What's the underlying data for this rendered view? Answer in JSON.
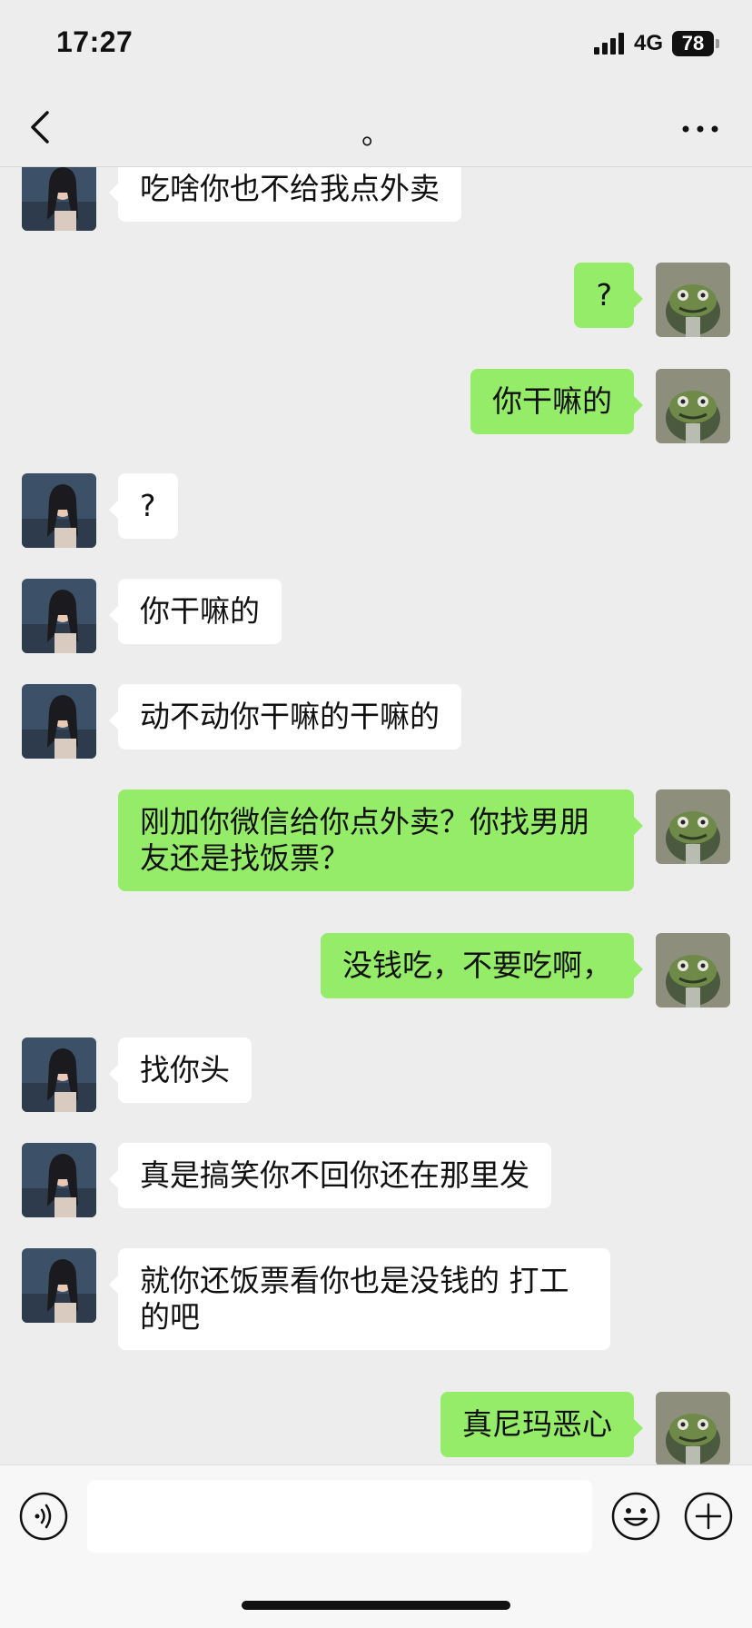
{
  "status_bar": {
    "time": "17:27",
    "network": "4G",
    "battery": "78"
  },
  "nav": {
    "title": "。"
  },
  "messages": [
    {
      "side": "left",
      "text": "吃啥你也不给我点外卖"
    },
    {
      "side": "right",
      "text": "?"
    },
    {
      "side": "right",
      "text": "你干嘛的"
    },
    {
      "side": "left",
      "text": "?"
    },
    {
      "side": "left",
      "text": "你干嘛的"
    },
    {
      "side": "left",
      "text": "动不动你干嘛的干嘛的"
    },
    {
      "side": "right",
      "text": "刚加你微信给你点外卖？你找男朋友还是找饭票？"
    },
    {
      "side": "right",
      "text": "没钱吃，不要吃啊，"
    },
    {
      "side": "left",
      "text": "找你头"
    },
    {
      "side": "left",
      "text": "真是搞笑你不回你还在那里发"
    },
    {
      "side": "left",
      "text": "就你还饭票看你也是没钱的 打工的吧"
    },
    {
      "side": "right",
      "text": "真尼玛恶心"
    }
  ],
  "input": {
    "value": "",
    "placeholder": ""
  },
  "icons": {
    "back": "back-chevron-icon",
    "more": "more-dots-icon",
    "voice": "voice-icon",
    "emoji": "emoji-icon",
    "plus": "plus-icon",
    "signal": "signal-icon"
  },
  "colors": {
    "background": "#ededed",
    "sent_bubble": "#95ec69",
    "received_bubble": "#ffffff"
  }
}
